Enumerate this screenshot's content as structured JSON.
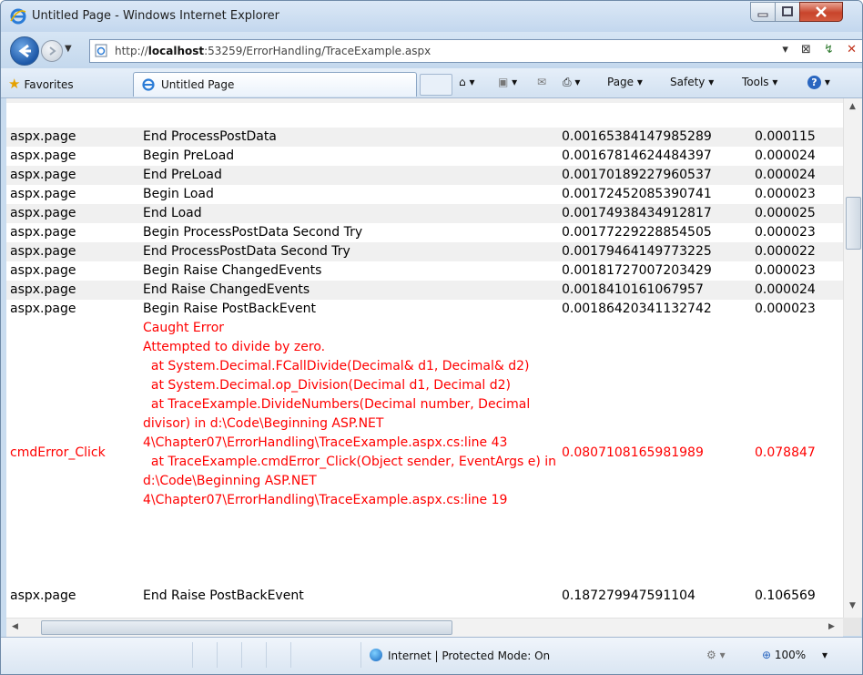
{
  "window": {
    "title": "Untitled Page - Windows Internet Explorer"
  },
  "address_bar": {
    "url_prefix": "http://",
    "url_host": "localhost",
    "url_rest": ":53259/ErrorHandling/TraceExample.aspx"
  },
  "favorites_bar": {
    "favorites_label": "Favorites",
    "tab_title": "Untitled Page"
  },
  "command_bar": {
    "page_label": "Page ▾",
    "safety_label": "Safety ▾",
    "tools_label": "Tools ▾"
  },
  "trace_rows": [
    {
      "category": "aspx.page",
      "message": "End ProcessPostData",
      "from_first": "0.00165384147985289",
      "from_last": "0.000115",
      "style": "alt"
    },
    {
      "category": "aspx.page",
      "message": "Begin PreLoad",
      "from_first": "0.00167814624484397",
      "from_last": "0.000024",
      "style": "normal"
    },
    {
      "category": "aspx.page",
      "message": "End PreLoad",
      "from_first": "0.00170189227960537",
      "from_last": "0.000024",
      "style": "alt"
    },
    {
      "category": "aspx.page",
      "message": "Begin Load",
      "from_first": "0.00172452085390741",
      "from_last": "0.000023",
      "style": "normal"
    },
    {
      "category": "aspx.page",
      "message": "End Load",
      "from_first": "0.00174938434912817",
      "from_last": "0.000025",
      "style": "alt"
    },
    {
      "category": "aspx.page",
      "message": "Begin ProcessPostData Second Try",
      "from_first": "0.00177229228854505",
      "from_last": "0.000023",
      "style": "normal"
    },
    {
      "category": "aspx.page",
      "message": "End ProcessPostData Second Try",
      "from_first": "0.00179464149773225",
      "from_last": "0.000022",
      "style": "alt"
    },
    {
      "category": "aspx.page",
      "message": "Begin Raise ChangedEvents",
      "from_first": "0.00181727007203429",
      "from_last": "0.000023",
      "style": "normal"
    },
    {
      "category": "aspx.page",
      "message": "End Raise ChangedEvents",
      "from_first": "0.0018410161067957",
      "from_last": "0.000024",
      "style": "alt"
    },
    {
      "category": "aspx.page",
      "message": "Begin Raise PostBackEvent",
      "from_first": "0.00186420341132742",
      "from_last": "0.000023",
      "style": "normal"
    },
    {
      "category": "cmdError_Click",
      "message": "Caught Error\nAttempted to divide by zero.\n  at System.Decimal.FCallDivide(Decimal& d1, Decimal& d2)\n  at System.Decimal.op_Division(Decimal d1, Decimal d2)\n  at TraceExample.DivideNumbers(Decimal number, Decimal divisor) in d:\\Code\\Beginning ASP.NET 4\\Chapter07\\ErrorHandling\\TraceExample.aspx.cs:line 43\n  at TraceExample.cmdError_Click(Object sender, EventArgs e) in d:\\Code\\Beginning ASP.NET 4\\Chapter07\\ErrorHandling\\TraceExample.aspx.cs:line 19",
      "from_first": "0.0807108165981989",
      "from_last": "0.078847",
      "style": "err"
    },
    {
      "category": "aspx.page",
      "message": "End Raise PostBackEvent",
      "from_first": "0.187279947591104",
      "from_last": "0.106569",
      "style": "normal"
    }
  ],
  "status_bar": {
    "zone_text": "Internet | Protected Mode: On",
    "zoom_text": "100%"
  },
  "colors": {
    "error_text": "#ff0000",
    "alt_row": "#f0f0f0"
  },
  "icons": [
    "ie-logo-icon",
    "back-arrow-icon",
    "forward-arrow-icon",
    "refresh-icon",
    "stop-icon",
    "home-icon",
    "feeds-icon",
    "mail-icon",
    "print-icon",
    "help-icon",
    "star-icon",
    "globe-icon",
    "magnifier-icon"
  ]
}
